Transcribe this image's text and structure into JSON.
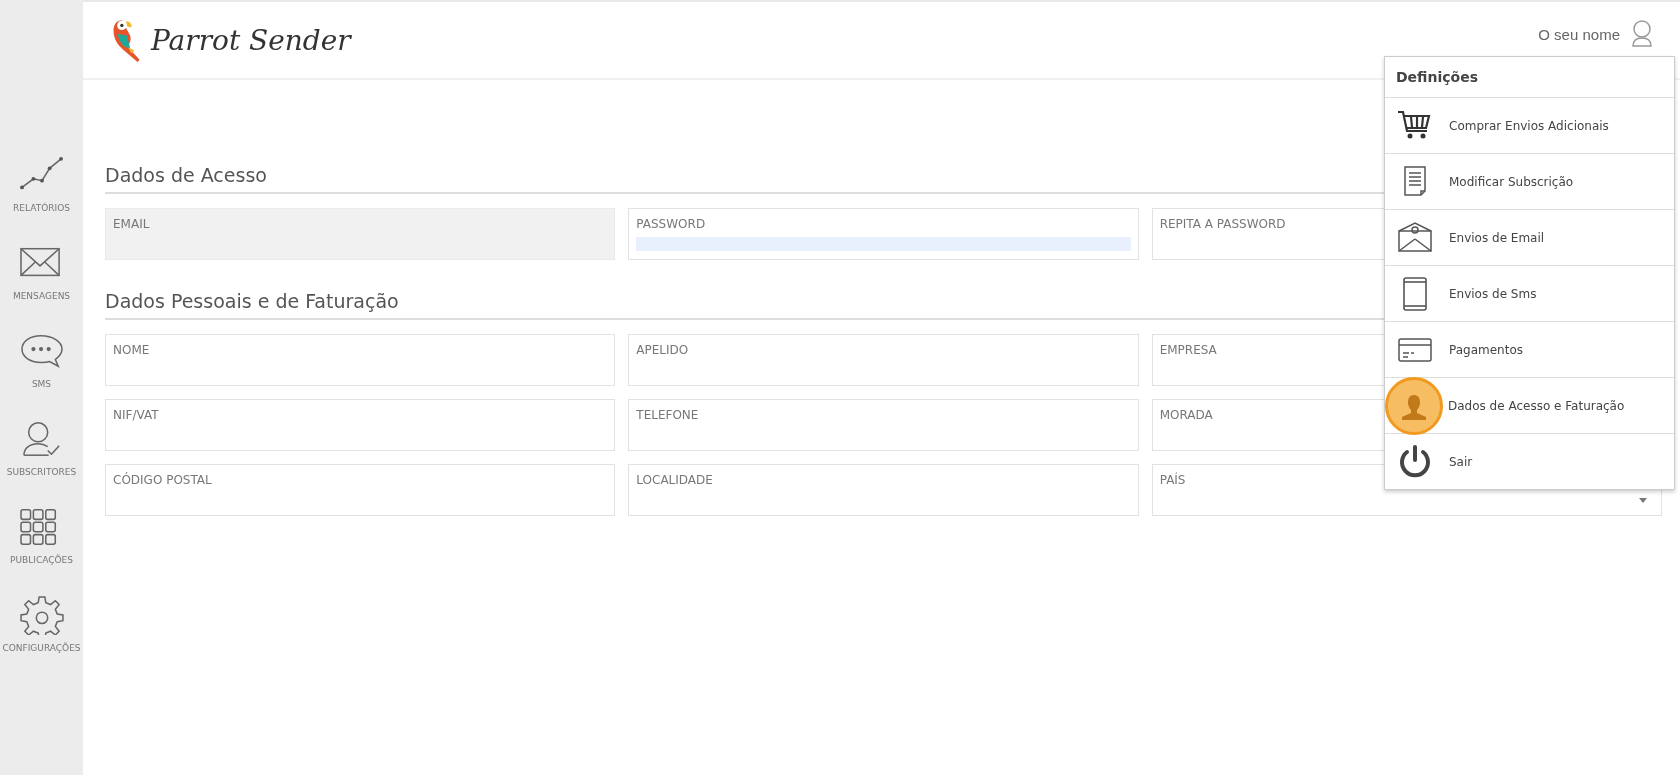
{
  "sidebar": {
    "items": [
      {
        "label": "RELATÓRIOS",
        "kind": "chart"
      },
      {
        "label": "MENSAGENS",
        "kind": "envelope"
      },
      {
        "label": "SMS",
        "kind": "bubble"
      },
      {
        "label": "SUBSCRITORES",
        "kind": "person-check"
      },
      {
        "label": "PUBLICAÇÕES",
        "kind": "grid"
      },
      {
        "label": "CONFIGURAÇÕES",
        "kind": "gear"
      }
    ]
  },
  "header": {
    "logo_text": "Parrot Sender",
    "user_name": "O seu nome"
  },
  "sections": [
    {
      "title": "Dados de Acesso",
      "fields": [
        {
          "label": "EMAIL",
          "kind": "text",
          "disabled": true,
          "autofilled": false
        },
        {
          "label": "PASSWORD",
          "kind": "text",
          "disabled": false,
          "autofilled": true
        },
        {
          "label": "REPITA A PASSWORD",
          "kind": "text",
          "disabled": false,
          "autofilled": false
        }
      ]
    },
    {
      "title": "Dados Pessoais e de Faturação",
      "fields": [
        {
          "label": "NOME",
          "kind": "text",
          "disabled": false,
          "autofilled": false
        },
        {
          "label": "APELIDO",
          "kind": "text",
          "disabled": false,
          "autofilled": false
        },
        {
          "label": "EMPRESA",
          "kind": "text",
          "disabled": false,
          "autofilled": false
        },
        {
          "label": "NIF/VAT",
          "kind": "text",
          "disabled": false,
          "autofilled": false
        },
        {
          "label": "TELEFONE",
          "kind": "text",
          "disabled": false,
          "autofilled": false
        },
        {
          "label": "MORADA",
          "kind": "text",
          "disabled": false,
          "autofilled": false
        },
        {
          "label": "CÓDIGO POSTAL",
          "kind": "text",
          "disabled": false,
          "autofilled": false
        },
        {
          "label": "LOCALIDADE",
          "kind": "text",
          "disabled": false,
          "autofilled": false
        },
        {
          "label": "PAÍS",
          "kind": "select",
          "disabled": false,
          "autofilled": false
        }
      ]
    }
  ],
  "menu": {
    "title": "Definições",
    "items": [
      {
        "label": "Comprar Envios Adicionais",
        "kind": "cart",
        "selected": false
      },
      {
        "label": "Modificar Subscrição",
        "kind": "document",
        "selected": false
      },
      {
        "label": "Envios de Email",
        "kind": "email",
        "selected": false
      },
      {
        "label": "Envios de Sms",
        "kind": "phone",
        "selected": false
      },
      {
        "label": "Pagamentos",
        "kind": "card",
        "selected": false
      },
      {
        "label": "Dados de Acesso e Faturação",
        "kind": "person",
        "selected": true
      },
      {
        "label": "Sair",
        "kind": "power",
        "selected": false
      }
    ]
  }
}
